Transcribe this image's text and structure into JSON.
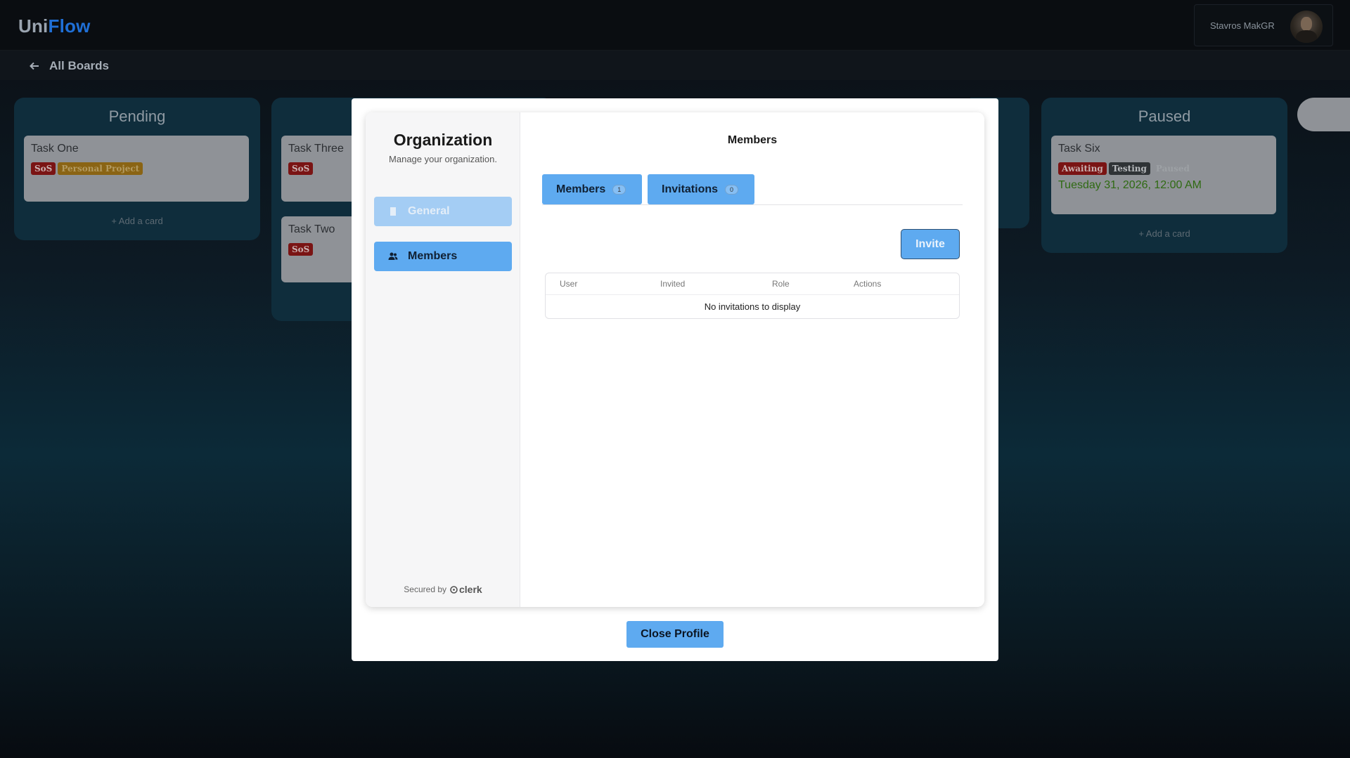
{
  "app": {
    "logo_part1": "Uni",
    "logo_part2": "Flow",
    "user_name": "Stavros MakGR",
    "back_label": "All Boards"
  },
  "board": {
    "columns": [
      {
        "title": "Pending",
        "cards": [
          {
            "title": "Task One",
            "tags": [
              "SoS",
              "Personal Project"
            ]
          }
        ],
        "add_label": "+ Add a card"
      },
      {
        "title": "",
        "cards": [
          {
            "title": "Task Three",
            "tags": [
              "SoS"
            ]
          },
          {
            "title": "Task Two",
            "tags": [
              "SoS"
            ]
          }
        ]
      },
      {
        "title": "Paused",
        "cards": [
          {
            "title": "Task Six",
            "tags": [
              "Awaiting",
              "Testing",
              "Paused"
            ],
            "due": "Tuesday 31, 2026, 12:00 AM"
          }
        ],
        "add_label": "+ Add a card"
      }
    ]
  },
  "modal": {
    "sidebar": {
      "title": "Organization",
      "subtitle": "Manage your organization.",
      "items": [
        {
          "label": "General",
          "icon": "building-icon",
          "active": false
        },
        {
          "label": "Members",
          "icon": "users-icon",
          "active": true
        }
      ],
      "secured_by": "Secured by",
      "brand": "clerk"
    },
    "main": {
      "title": "Members",
      "tabs": [
        {
          "label": "Members",
          "count": "1"
        },
        {
          "label": "Invitations",
          "count": "0"
        }
      ],
      "invite_label": "Invite",
      "table": {
        "headers": [
          "User",
          "Invited",
          "Role",
          "Actions"
        ],
        "empty_text": "No invitations to display"
      }
    },
    "close_label": "Close Profile"
  },
  "colors": {
    "accent": "#5eaaf0",
    "accent_light": "#a4cdf4",
    "brand_blue": "#1f6fd6"
  }
}
